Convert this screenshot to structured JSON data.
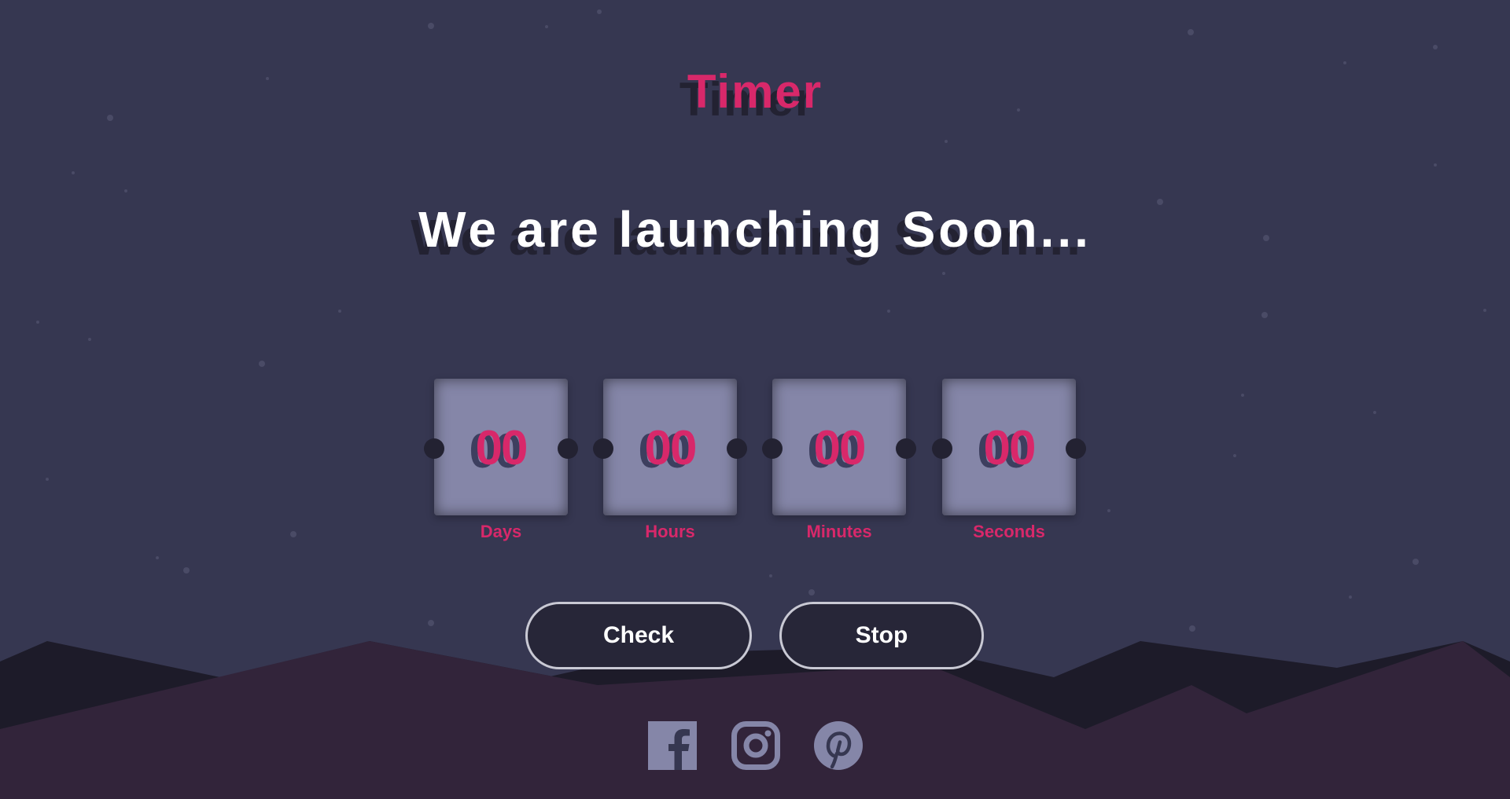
{
  "header": {
    "title": "Timer"
  },
  "main": {
    "headline": "We are launching Soon...",
    "countdown": [
      {
        "value": "00",
        "label": "Days"
      },
      {
        "value": "00",
        "label": "Hours"
      },
      {
        "value": "00",
        "label": "Minutes"
      },
      {
        "value": "00",
        "label": "Seconds"
      }
    ],
    "buttons": {
      "check": "Check",
      "stop": "Stop"
    }
  },
  "social": [
    {
      "icon": "facebook-icon"
    },
    {
      "icon": "instagram-icon"
    },
    {
      "icon": "pinterest-icon"
    }
  ],
  "colors": {
    "background": "#363751",
    "accent": "#d8286a",
    "card": "#8586a8",
    "icon": "#8586a8",
    "mountain_front": "#32243a",
    "mountain_back": "#1d1b29"
  }
}
